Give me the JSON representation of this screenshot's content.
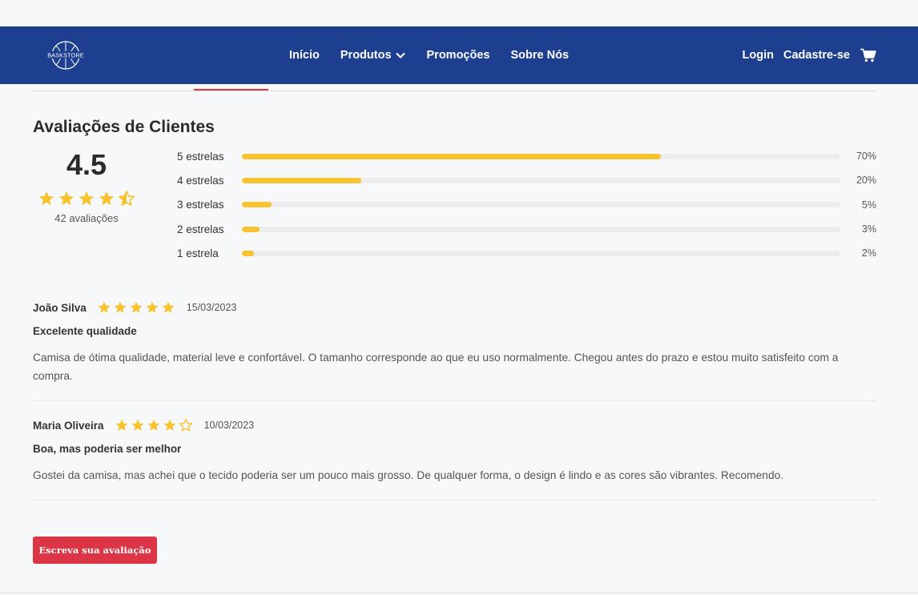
{
  "header": {
    "logo_text": "BASKSTORE",
    "nav": [
      {
        "label": "Início"
      },
      {
        "label": "Produtos"
      },
      {
        "label": "Promoções"
      },
      {
        "label": "Sobre Nós"
      }
    ],
    "login_label": "Login",
    "signup_label": "Cadastre-se",
    "cart_icon": "cart-icon"
  },
  "reviews_section": {
    "title": "Avaliações de Clientes",
    "average": "4.5",
    "average_rating": 4.5,
    "count_label": "42 avaliações",
    "distribution": [
      {
        "label": "5 estrelas",
        "percent_label": "70%",
        "percent": 70
      },
      {
        "label": "4 estrelas",
        "percent_label": "20%",
        "percent": 20
      },
      {
        "label": "3 estrelas",
        "percent_label": "5%",
        "percent": 5
      },
      {
        "label": "2 estrelas",
        "percent_label": "3%",
        "percent": 3
      },
      {
        "label": "1 estrela",
        "percent_label": "2%",
        "percent": 2
      }
    ]
  },
  "reviews": [
    {
      "name": "João Silva",
      "rating": 5,
      "date": "15/03/2023",
      "title": "Excelente qualidade",
      "body": "Camisa de ótima qualidade, material leve e confortável. O tamanho corresponde ao que eu uso normalmente. Chegou antes do prazo e estou muito satisfeito com a compra."
    },
    {
      "name": "Maria Oliveira",
      "rating": 4,
      "date": "10/03/2023",
      "title": "Boa, mas poderia ser melhor",
      "body": "Gostei da camisa, mas achei que o tecido poderia ser um pouco mais grosso. De qualquer forma, o design é lindo e as cores são vibrantes. Recomendo."
    }
  ],
  "write_review_label": "Escreva sua avaliação",
  "colors": {
    "navbar": "#1e3f8f",
    "accent_red": "#dc3545",
    "star_yellow": "#f7c42f",
    "track_gray": "#ececec"
  }
}
